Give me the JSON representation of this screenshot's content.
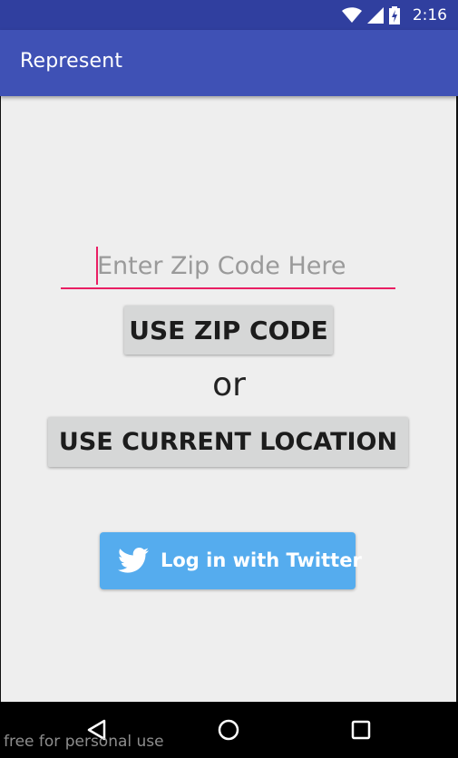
{
  "status_bar": {
    "time": "2:16",
    "icons": [
      "wifi-icon",
      "signal-icon",
      "battery-charging-icon"
    ]
  },
  "app_bar": {
    "title": "Represent"
  },
  "zip_input": {
    "placeholder": "Enter Zip Code Here",
    "value": ""
  },
  "buttons": {
    "use_zip_label": "USE ZIP CODE",
    "or_label": "or",
    "use_location_label": "USE CURRENT LOCATION",
    "twitter_label": "Log in with Twitter"
  },
  "nav_bar": {
    "icons": [
      "back-icon",
      "home-icon",
      "recents-icon"
    ]
  },
  "watermark": {
    "text": "free for personal use"
  },
  "colors": {
    "status_bar": "#303f9f",
    "app_bar": "#3f51b5",
    "accent": "#e91e63",
    "twitter": "#55acee",
    "button_gray": "#d6d7d7",
    "background": "#eeeeee"
  }
}
